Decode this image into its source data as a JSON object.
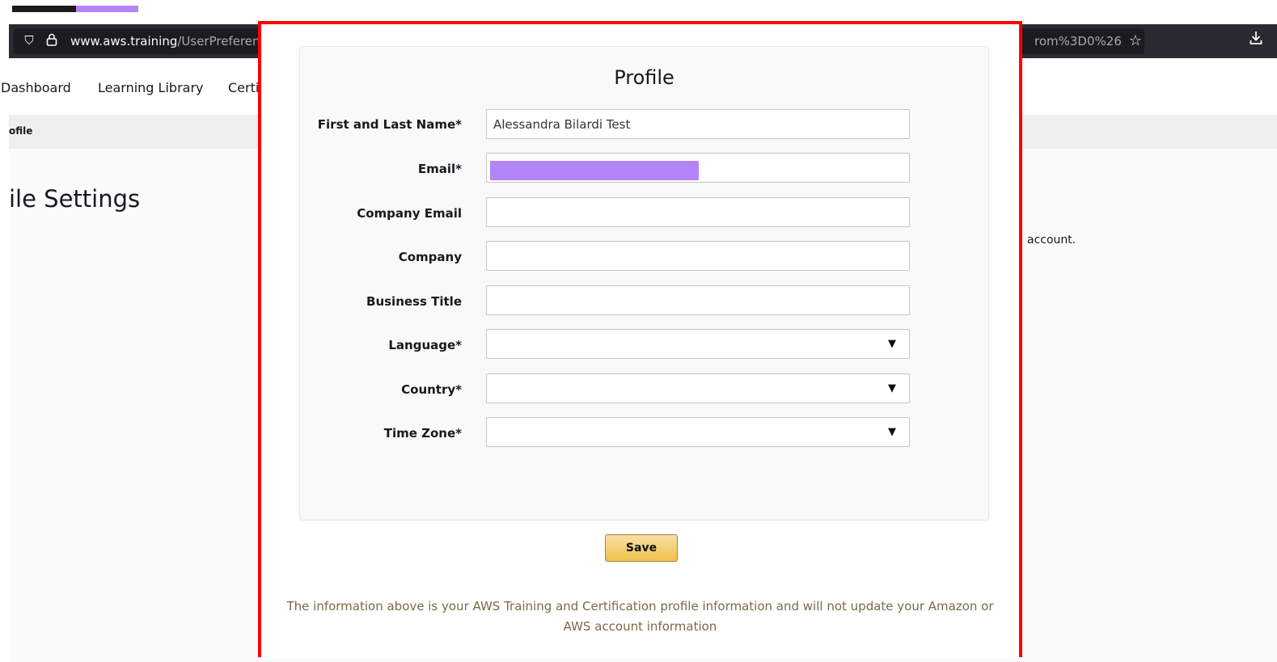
{
  "browser": {
    "url_host": "www.aws.training",
    "url_path": "/UserPreferenc",
    "url_tail": "rom%3D0%26",
    "icons": [
      "shield-icon",
      "lock-icon",
      "star-icon",
      "download-icon"
    ]
  },
  "nav": {
    "items": [
      "Dashboard",
      "Learning Library",
      "Certi"
    ]
  },
  "breadcrumb": {
    "current": "ofile"
  },
  "page": {
    "title": "ile Settings",
    "side_note": "account."
  },
  "profile_form": {
    "title": "Profile",
    "fields": [
      {
        "label": "First and Last Name*",
        "value": "Alessandra Bilardi Test",
        "type": "text"
      },
      {
        "label": "Email*",
        "value": "",
        "type": "text",
        "redacted": true
      },
      {
        "label": "Company Email",
        "value": "",
        "type": "text"
      },
      {
        "label": "Company",
        "value": "",
        "type": "text"
      },
      {
        "label": "Business Title",
        "value": "",
        "type": "text"
      },
      {
        "label": "Language*",
        "value": "",
        "type": "select"
      },
      {
        "label": "Country*",
        "value": "",
        "type": "select"
      },
      {
        "label": "Time Zone*",
        "value": "",
        "type": "select"
      }
    ],
    "save_label": "Save",
    "footnote": "The information above is your AWS Training and Certification profile information and will not update your Amazon or AWS account information"
  },
  "colors": {
    "highlight_border": "#ff0000",
    "redaction": "#b384f6",
    "save_button": "#f0c14b",
    "footnote_text": "#7a6a44"
  }
}
